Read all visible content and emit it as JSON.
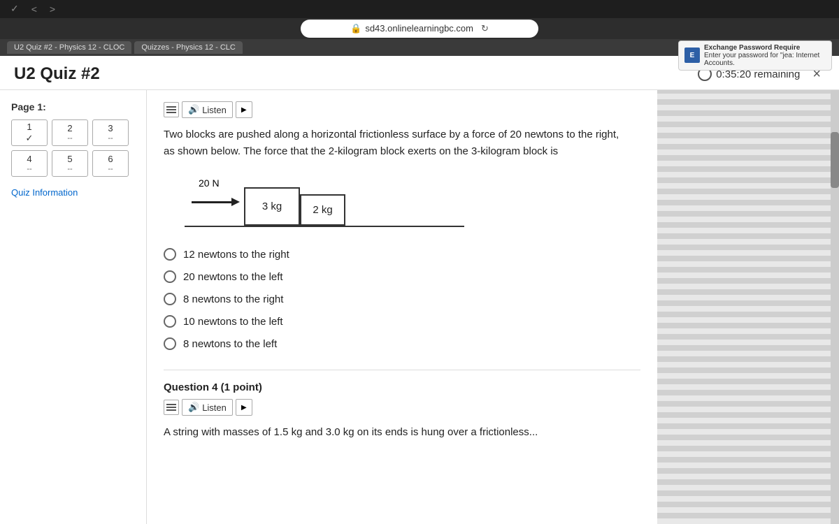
{
  "browser": {
    "url": "sd43.onlinelearningbc.com",
    "tab1_label": "U2 Quiz #2 - Physics 12 - CLOC",
    "tab2_label": "Quizzes - Physics 12 - CLC",
    "nav_back": "<",
    "nav_forward": ">",
    "exchange_title": "Exchange Password Require",
    "exchange_body": "Enter your password for \"jea: Internet Accounts."
  },
  "quiz": {
    "title": "U2 Quiz #2",
    "timer": "0:35:20 remaining",
    "close_label": "×"
  },
  "sidebar": {
    "page_label": "Page 1:",
    "questions": [
      {
        "num": "1",
        "status": "✓"
      },
      {
        "num": "2",
        "status": "--"
      },
      {
        "num": "3",
        "status": "--"
      },
      {
        "num": "4",
        "status": "--"
      },
      {
        "num": "5",
        "status": "--"
      },
      {
        "num": "6",
        "status": "--"
      }
    ],
    "quiz_info_link": "Quiz Information"
  },
  "question3": {
    "listen_label": "Listen",
    "play_label": "▶",
    "question_text": "Two blocks are pushed along a horizontal frictionless surface by a force of 20 newtons to the right, as shown below. The force that the 2-kilogram block exerts on the 3-kilogram block is",
    "force_label": "20 N",
    "block1_label": "3 kg",
    "block2_label": "2 kg",
    "choices": [
      "12 newtons to the right",
      "20 newtons to the left",
      "8 newtons to the right",
      "10 newtons to the left",
      "8 newtons to the left"
    ]
  },
  "question4": {
    "label": "Question 4 (1 point)",
    "listen_label": "Listen",
    "play_label": "▶",
    "text": "A string with masses of 1.5 kg and 3.0 kg on its ends is hung over a frictionless..."
  }
}
